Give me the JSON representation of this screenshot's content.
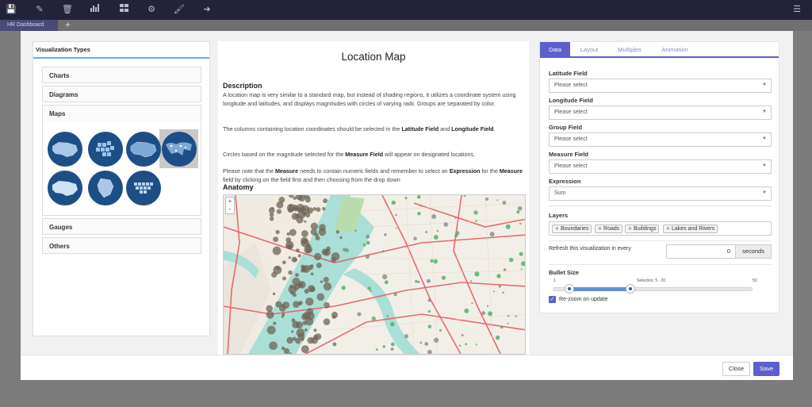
{
  "toolbar": {
    "icons": [
      "save-icon",
      "edit-icon",
      "trash-icon",
      "bar-chart-icon",
      "grid-icon",
      "gear-icon",
      "brush-icon",
      "sign-out-icon",
      "menu-icon"
    ]
  },
  "tabs": {
    "dashboard": "HR Dashboard",
    "add": "+"
  },
  "left": {
    "title": "Visualization Types",
    "sections": {
      "charts": "Charts",
      "diagrams": "Diagrams",
      "maps": "Maps",
      "gauges": "Gauges",
      "others": "Others"
    }
  },
  "middle": {
    "title": "Location Map",
    "description_heading": "Description",
    "desc1": "A location map is very similar to a standard map, but instead of shading regions, it utilizes a coordinate system using longitude and latitudes, and displays magnitudes with circles of varying radii. Groups are separated by color.",
    "desc2_pre": "The columns containing location coordinates should be selected in the ",
    "desc2_b1": "Latitude Field",
    "desc2_mid": " and ",
    "desc2_b2": "Longitude Field",
    "desc2_post": ".",
    "desc3_pre": "Circles based on the magnitude selected for the ",
    "desc3_b1": "Measure Field",
    "desc3_post": " will appear on designated locations.",
    "desc4_pre": "Please note that the ",
    "desc4_b1": "Measure",
    "desc4_mid1": " needs to contain numeric fields and remember to select an ",
    "desc4_b2": "Expression",
    "desc4_mid2": " for the ",
    "desc4_b3": "Measure",
    "desc4_post": " field by clicking on the field first and then choosing from the drop down",
    "anatomy_heading": "Anatomy",
    "zoom_in": "+",
    "zoom_out": "-"
  },
  "right": {
    "tabs": [
      "Data",
      "Layout",
      "Multiples",
      "Animation"
    ],
    "latitude_label": "Latitude Field",
    "longitude_label": "Longitude Field",
    "group_label": "Group Field",
    "measure_label": "Measure Field",
    "placeholder": "Please select",
    "expression_label": "Expression",
    "expression_value": "Sum",
    "layers_label": "Layers",
    "layers": [
      "Boundaries",
      "Roads",
      "Buildings",
      "Lakes and Rivers"
    ],
    "refresh_label": "Refresh this visualization in every",
    "refresh_value": "0",
    "refresh_unit": "seconds",
    "bullet_label": "Bullet Size",
    "slider_min": "1",
    "slider_max": "50",
    "slider_selection": "Selection: 5 - 20",
    "slider_low": 5,
    "slider_high": 20,
    "rezoom_label": "Re-zoom on update",
    "rezoom_checked": true
  },
  "footer": {
    "close": "Close",
    "save": "Save"
  },
  "colors": {
    "accent": "#5d5fce",
    "toolbar": "#22223a",
    "map_water": "#a9dfd7",
    "map_road": "#e85b5b"
  }
}
